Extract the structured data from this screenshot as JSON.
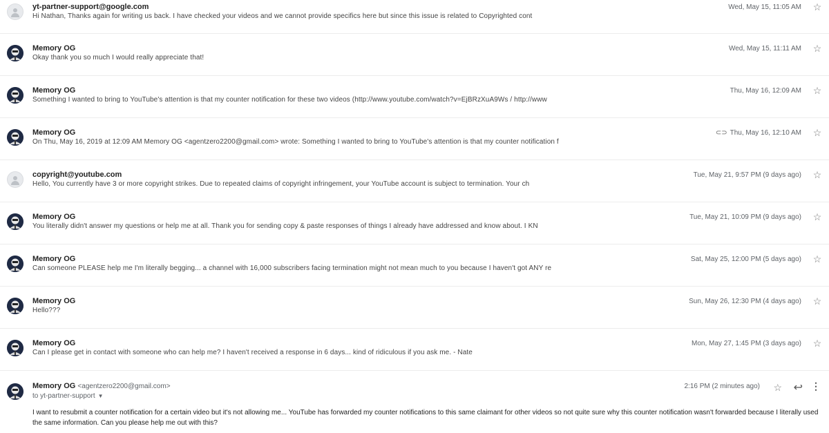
{
  "messages": [
    {
      "sender": "yt-partner-support@google.com",
      "snippet": "Hi Nathan, Thanks again for writing us back. I have checked your videos and we cannot provide specifics here but since this issue is related to Copyrighted cont",
      "date": "Wed, May 15, 11:05 AM",
      "avatar": "generic",
      "attachment": false
    },
    {
      "sender": "Memory OG",
      "snippet": "Okay thank you so much I would really appreciate that!",
      "date": "Wed, May 15, 11:11 AM",
      "avatar": "og",
      "attachment": false
    },
    {
      "sender": "Memory OG",
      "snippet": "Something I wanted to bring to YouTube's attention is that my counter notification for these two videos (http://www.youtube.com/watch?v=EjBRzXuA9Ws / http://www",
      "date": "Thu, May 16, 12:09 AM",
      "avatar": "og",
      "attachment": false
    },
    {
      "sender": "Memory OG",
      "snippet": "On Thu, May 16, 2019 at 12:09 AM Memory OG <agentzero2200@gmail.com> wrote: Something I wanted to bring to YouTube's attention is that my counter notification f",
      "date": "Thu, May 16, 12:10 AM",
      "avatar": "og",
      "attachment": true
    },
    {
      "sender": "copyright@youtube.com",
      "snippet": "Hello, You currently have 3 or more copyright strikes. Due to repeated claims of copyright infringement, your YouTube account is subject to termination. Your ch",
      "date": "Tue, May 21, 9:57 PM (9 days ago)",
      "avatar": "generic",
      "attachment": false
    },
    {
      "sender": "Memory OG",
      "snippet": "You literally didn't answer my questions or help me at all. Thank you for sending copy & paste responses of things I already have addressed and know about. I KN",
      "date": "Tue, May 21, 10:09 PM (9 days ago)",
      "avatar": "og",
      "attachment": false
    },
    {
      "sender": "Memory OG",
      "snippet": "Can someone PLEASE help me I'm literally begging... a channel with 16,000 subscribers facing termination might not mean much to you because I haven't got ANY re",
      "date": "Sat, May 25, 12:00 PM (5 days ago)",
      "avatar": "og",
      "attachment": false
    },
    {
      "sender": "Memory OG",
      "snippet": "Hello???",
      "date": "Sun, May 26, 12:30 PM (4 days ago)",
      "avatar": "og",
      "attachment": false
    },
    {
      "sender": "Memory OG",
      "snippet": "Can I please get in contact with someone who can help me? I haven't received a response in 6 days... kind of ridiculous if you ask me. - Nate",
      "date": "Mon, May 27, 1:45 PM (3 days ago)",
      "avatar": "og",
      "attachment": false
    }
  ],
  "expanded": {
    "sender": "Memory OG",
    "email": "<agentzero2200@gmail.com>",
    "to": "to yt-partner-support",
    "date": "2:16 PM (2 minutes ago)",
    "body": "I want to resubmit a counter notification for a certain video but it's not allowing me... YouTube has forwarded my counter notifications to this same claimant for other videos so not quite sure why this counter notification wasn't forwarded because I literally used the same information. Can you please help me out with this?"
  },
  "icons": {
    "star": "star-outline-icon",
    "reply": "reply-icon",
    "more": "more-vertical-icon",
    "attachment": "paperclip-icon"
  }
}
